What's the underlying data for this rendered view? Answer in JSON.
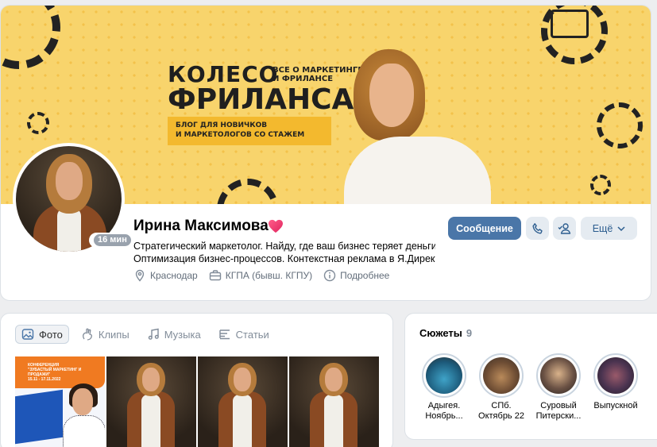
{
  "cover": {
    "title_line1": "КОЛЕСО",
    "title_line2": "ФРИЛАНСА",
    "subtitle_line1": "ВСЕ О МАРКЕТИНГЕ",
    "subtitle_line2": "И ФРИЛАНСЕ",
    "badge_line1": "БЛОГ ДЛЯ НОВИЧКОВ",
    "badge_line2": "И МАРКЕТОЛОГОВ СО СТАЖЕМ"
  },
  "profile": {
    "name": "Ирина Максимова",
    "online_status": "16 мин",
    "status_line1": "Стратегический маркетолог. Найду, где ваш бизнес теряет деньги.",
    "status_line2": "Оптимизация бизнес-процессов. Контекстная реклама в Я.Директ...",
    "city": "Краснодар",
    "education": "КГПА (бывш. КГПУ)",
    "details_link": "Подробнее"
  },
  "actions": {
    "message_label": "Сообщение",
    "more_label": "Ещё"
  },
  "media": {
    "tabs": [
      {
        "label": "Фото",
        "icon": "photo-icon",
        "active": true
      },
      {
        "label": "Клипы",
        "icon": "clips-icon",
        "active": false
      },
      {
        "label": "Музыка",
        "icon": "music-icon",
        "active": false
      },
      {
        "label": "Статьи",
        "icon": "articles-icon",
        "active": false
      }
    ],
    "conference_text_line1": "КОНФЕРЕНЦИЯ",
    "conference_text_line2": "\"ЗУБАСТЫЙ МАРКЕТИНГ И ПРОДАЖИ\"",
    "conference_date": "15.11 - 17.11.2022"
  },
  "stories": {
    "title": "Сюжеты",
    "count": "9",
    "items": [
      {
        "label_line1": "Адыгея.",
        "label_line2": "Ноябрь..."
      },
      {
        "label_line1": "СПб.",
        "label_line2": "Октябрь 22"
      },
      {
        "label_line1": "Суровый",
        "label_line2": "Питерски..."
      },
      {
        "label_line1": "Выпускной",
        "label_line2": ""
      }
    ]
  },
  "colors": {
    "accent": "#4a76a8",
    "cover_yellow": "#f8d46c",
    "secondary_button": "#e5ebf1",
    "link": "#2c5d8f"
  }
}
